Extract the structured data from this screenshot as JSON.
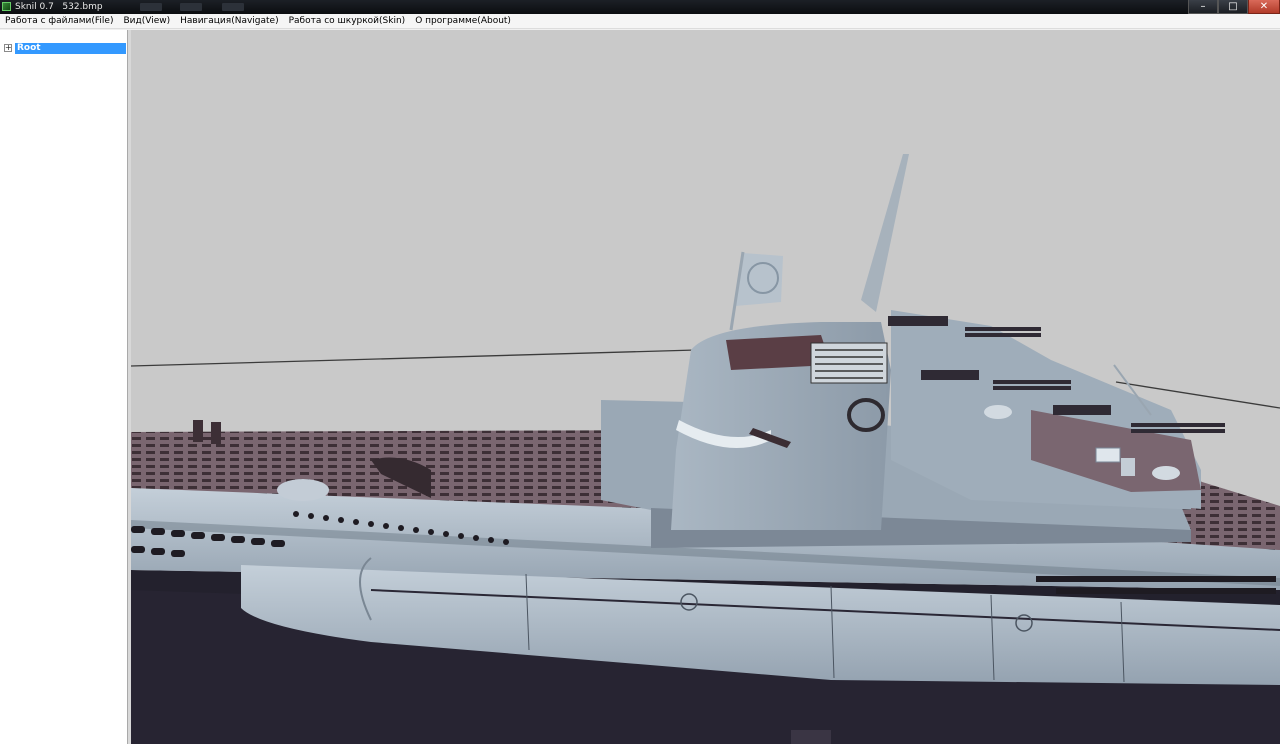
{
  "window": {
    "title": "Sknil 0.7   532.bmp",
    "buttons": {
      "minimize": "–",
      "maximize": "□",
      "close": "✕"
    }
  },
  "menu": [
    {
      "label": "Работа с файлами(File)"
    },
    {
      "label": "Вид(View)"
    },
    {
      "label": "Навигация(Navigate)"
    },
    {
      "label": "Работа со шкуркой(Skin)"
    },
    {
      "label": "О программе(About)"
    }
  ],
  "tree": {
    "expander": "+",
    "root_label": "Root"
  },
  "viewport": {
    "subject": "submarine-3d-model",
    "colors": {
      "background": "#c9c9c9",
      "hull": "#a9b6c2",
      "deck": "#6e5a63",
      "dark_hull": "#23212d"
    }
  }
}
